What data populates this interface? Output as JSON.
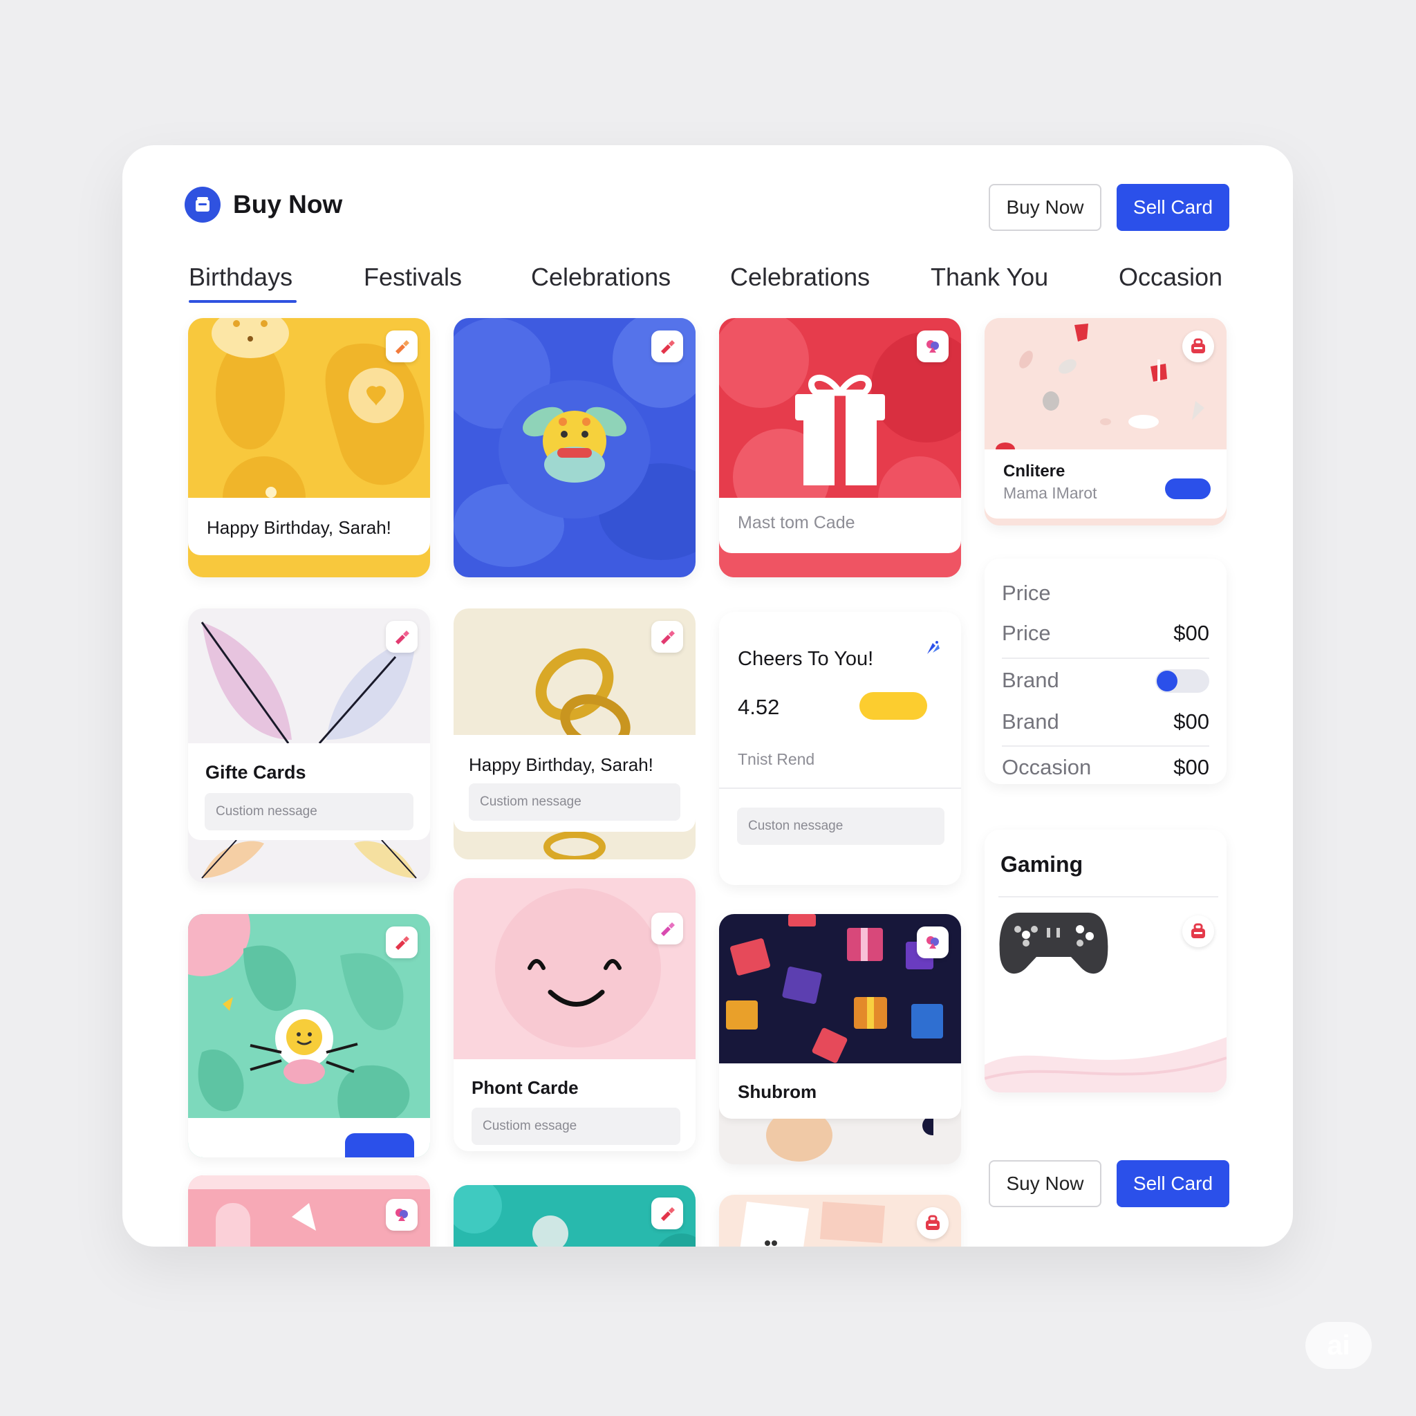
{
  "header": {
    "brand_title": "Buy Now",
    "buy_label": "Buy Now",
    "sell_label": "Sell Card"
  },
  "tabs": [
    {
      "label": "Birthdays",
      "active": true
    },
    {
      "label": "Festivals"
    },
    {
      "label": "Celebrations"
    },
    {
      "label": "Celebrations"
    },
    {
      "label": "Thank You"
    },
    {
      "label": "Occasion"
    }
  ],
  "cards": {
    "birthday_yellow": {
      "title": "Happy Birthday, Sarah!",
      "color": "#f8c83d"
    },
    "blue_character": {
      "color": "#3e5be0"
    },
    "red_gift": {
      "subtitle": "Mast tom Cade",
      "color": "#e63c4c"
    },
    "pink_confetti": {
      "title": "Cnlitere",
      "subtitle": "Mama IMarot"
    },
    "feather": {
      "title": "Gifte Cards",
      "placeholder": "Custiom nessage"
    },
    "gold_rings": {
      "title": "Happy Birthday, Sarah!",
      "placeholder": "Custiom nessage"
    },
    "cheers": {
      "title": "Cheers To You!",
      "value": "4.52",
      "subtitle": "Tnist Rend",
      "placeholder": "Custon nessage"
    },
    "green_friend": {
      "color": "#6fd3b4"
    },
    "smile_pink": {
      "title": "Phont Carde",
      "placeholder": "Custiom essage"
    },
    "gift_pattern": {
      "title": "Shubrom"
    },
    "gaming": {
      "title": "Gaming"
    }
  },
  "summary": {
    "heading": "Price",
    "rows": [
      {
        "label": "Price",
        "value": "$00"
      },
      {
        "label": "Brand",
        "toggle": true
      },
      {
        "label": "Brand",
        "value": "$00"
      },
      {
        "label": "Occasion",
        "value": "$00"
      }
    ]
  },
  "footer": {
    "buy_label": "Suy Now",
    "sell_label": "Sell Card"
  },
  "watermark": "ai",
  "colors": {
    "accent": "#2b50ea",
    "yellow_pill": "#fccd2f",
    "badge_red": "#e43a4a"
  }
}
